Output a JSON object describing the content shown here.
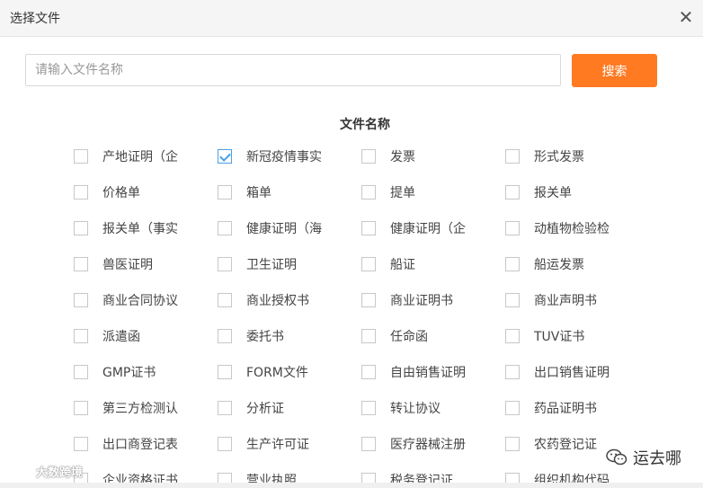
{
  "dialog": {
    "title": "选择文件",
    "close_glyph": "✕"
  },
  "search": {
    "placeholder": "请输入文件名称",
    "value": "",
    "button_label": "搜索"
  },
  "colors": {
    "accent": "#ff7a21",
    "check": "#4a9fe8"
  },
  "section_title": "文件名称",
  "items": [
    {
      "label": "产地证明（企",
      "checked": false
    },
    {
      "label": "新冠疫情事实",
      "checked": true
    },
    {
      "label": "发票",
      "checked": false
    },
    {
      "label": "形式发票",
      "checked": false
    },
    {
      "label": "价格单",
      "checked": false
    },
    {
      "label": "箱单",
      "checked": false
    },
    {
      "label": "提单",
      "checked": false
    },
    {
      "label": "报关单",
      "checked": false
    },
    {
      "label": "报关单（事实",
      "checked": false
    },
    {
      "label": "健康证明（海",
      "checked": false
    },
    {
      "label": "健康证明（企",
      "checked": false
    },
    {
      "label": "动植物检验检",
      "checked": false
    },
    {
      "label": "兽医证明",
      "checked": false
    },
    {
      "label": "卫生证明",
      "checked": false
    },
    {
      "label": "船证",
      "checked": false
    },
    {
      "label": "船运发票",
      "checked": false
    },
    {
      "label": "商业合同协议",
      "checked": false
    },
    {
      "label": "商业授权书",
      "checked": false
    },
    {
      "label": "商业证明书",
      "checked": false
    },
    {
      "label": "商业声明书",
      "checked": false
    },
    {
      "label": "派遣函",
      "checked": false
    },
    {
      "label": "委托书",
      "checked": false
    },
    {
      "label": "任命函",
      "checked": false
    },
    {
      "label": "TUV证书",
      "checked": false
    },
    {
      "label": "GMP证书",
      "checked": false
    },
    {
      "label": "FORM文件",
      "checked": false
    },
    {
      "label": "自由销售证明",
      "checked": false
    },
    {
      "label": "出口销售证明",
      "checked": false
    },
    {
      "label": "第三方检测认",
      "checked": false
    },
    {
      "label": "分析证",
      "checked": false
    },
    {
      "label": "转让协议",
      "checked": false
    },
    {
      "label": "药品证明书",
      "checked": false
    },
    {
      "label": "出口商登记表",
      "checked": false
    },
    {
      "label": "生产许可证",
      "checked": false
    },
    {
      "label": "医疗器械注册",
      "checked": false
    },
    {
      "label": "农药登记证",
      "checked": false
    },
    {
      "label": "企业资格证书",
      "checked": false
    },
    {
      "label": "营业执照",
      "checked": false
    },
    {
      "label": "税务登记证",
      "checked": false
    },
    {
      "label": "组织机构代码",
      "checked": false
    }
  ],
  "watermarks": {
    "left_text": "大数跨境",
    "right_text": "运去哪",
    "left_icon": "logo-icon",
    "right_icon": "wechat-icon"
  }
}
